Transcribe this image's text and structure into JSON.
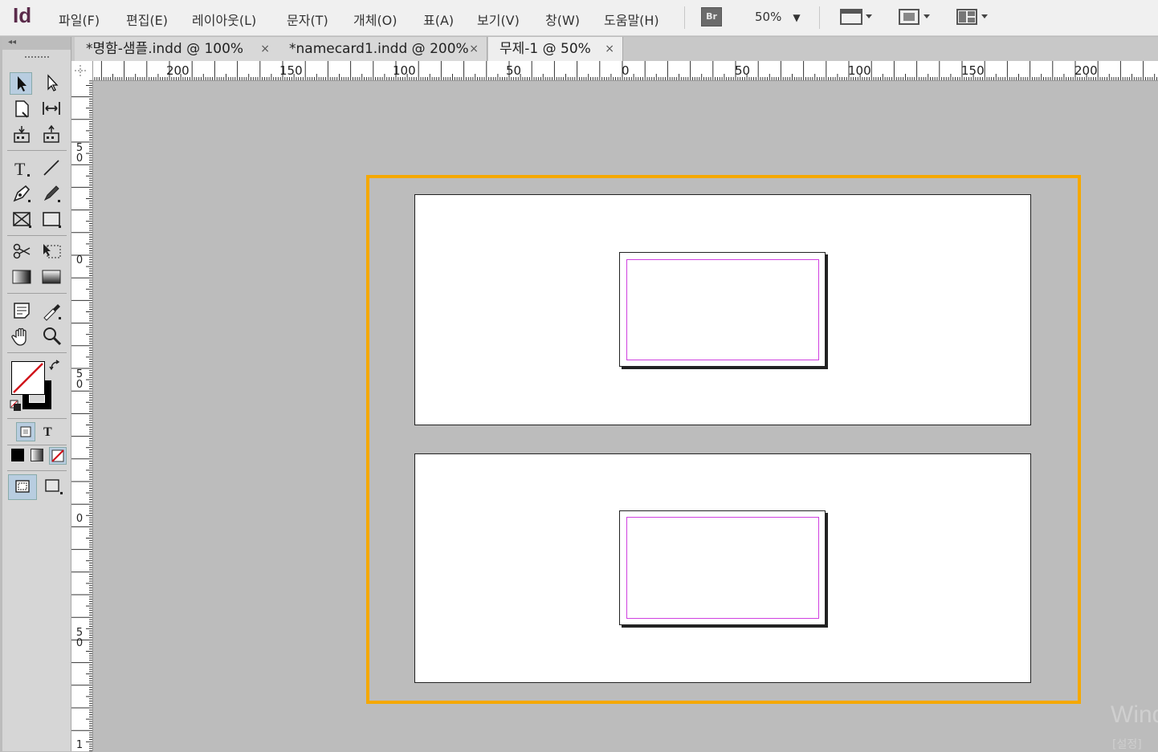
{
  "app": {
    "logo": "Id"
  },
  "menu": {
    "items": [
      "파일(F)",
      "편집(E)",
      "레이아웃(L)",
      "문자(T)",
      "개체(O)",
      "표(A)",
      "보기(V)",
      "창(W)",
      "도움말(H)"
    ],
    "bridge_label": "Br",
    "zoom": "50%"
  },
  "tabs": [
    {
      "label": "*명함-샘플.indd @ 100%",
      "close": "×",
      "active": false
    },
    {
      "label": "*namecard1.indd @ 200%",
      "close": "×",
      "active": false
    },
    {
      "label": "무제-1 @ 50%",
      "close": "×",
      "active": true
    }
  ],
  "rulers": {
    "horizontal_labels": [
      "200",
      "150",
      "100",
      "50",
      "0",
      "50",
      "100",
      "150",
      "200"
    ],
    "vertical_labels": [
      "5\n0",
      "0",
      "5\n0",
      "0",
      "5\n0",
      "1"
    ]
  },
  "tools_panel": {
    "collapse_label": "◂◂"
  },
  "colors": {
    "selection": "#f5a800",
    "margin_guides": "#d040e0"
  },
  "watermark": {
    "text": "Wind",
    "sub": "[설정]"
  }
}
